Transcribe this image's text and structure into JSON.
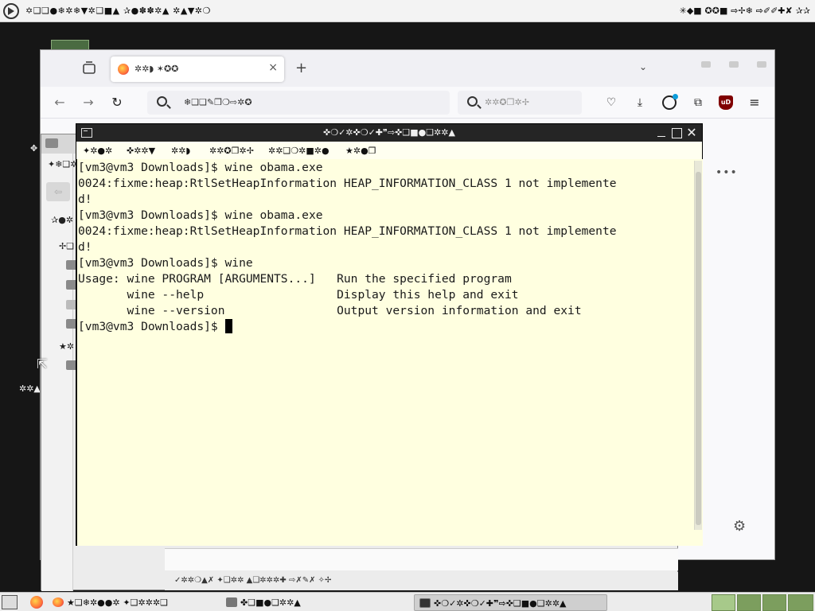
{
  "top_panel": {
    "menu_text": "✡❑❏●❄✲❄▼✲❑■▲  ✰●✽✽✲▲  ✲▲▼✲❍",
    "clock_text": "✳◆■ ✪✪■ ⇨✢❄ ⇨✐✐✚✘ ✰✰"
  },
  "desktop": {
    "frag_left_1": "✥",
    "frag_left_2": "✲✲▲"
  },
  "firefox": {
    "tab": {
      "title": "✲✲◗ ✶✪✪",
      "close": "×"
    },
    "new_tab": "+",
    "dropdown": "⌄",
    "nav": {
      "back": "←",
      "forward": "→",
      "reload": "↻"
    },
    "url_text": "❄❑❏✎❒❍⇨✲✪",
    "search_placeholder": "✲✲✪❒✲✢",
    "toolbar_icons": {
      "pocket": "♡",
      "download": "⤓",
      "account": "◉",
      "extensions": "⧉",
      "ublock": "uD",
      "menu": "≡"
    },
    "more_dots": "•••",
    "gear": "⚙"
  },
  "file_manager": {
    "sidebar": [
      "✦❄❑✲",
      "✰●✲",
      "✢❑",
      "★✲"
    ],
    "back_arrow": "⇦",
    "status_text": "✓✲✲❍▲✗ ✦❑✲✲ ▲❑✲✲✲✚ ⇨✗✎✗ ✧✢"
  },
  "terminal": {
    "title": "✜❍✓✲✜❍✓✚❞⇨✜❑■●❑✲✲▲",
    "menu": [
      "✦✲●✲",
      "✜✲✲▼",
      "✲✲◗",
      "✲✲✪❒✲✢",
      "✲✲❑❍✲■✲●",
      "★✲●❒"
    ],
    "lines": [
      "[vm3@vm3 Downloads]$ wine obama.exe",
      "0024:fixme:heap:RtlSetHeapInformation HEAP_INFORMATION_CLASS 1 not implemente",
      "d!",
      "[vm3@vm3 Downloads]$ wine obama.exe",
      "0024:fixme:heap:RtlSetHeapInformation HEAP_INFORMATION_CLASS 1 not implemente",
      "d!",
      "[vm3@vm3 Downloads]$ wine",
      "Usage: wine PROGRAM [ARGUMENTS...]   Run the specified program",
      "       wine --help                   Display this help and exit",
      "       wine --version                Output version information and exit"
    ],
    "prompt": "[vm3@vm3 Downloads]$ "
  },
  "taskbar": {
    "items": [
      {
        "label": "★❑❄✲●●✲ ✦❑✲✲✲❑"
      },
      {
        "label": "✤❑■●❑✲✲▲"
      },
      {
        "label": "✜❍✓✲✜❍✓✚❞⇨✜❑■●❑✲✲▲"
      }
    ]
  }
}
